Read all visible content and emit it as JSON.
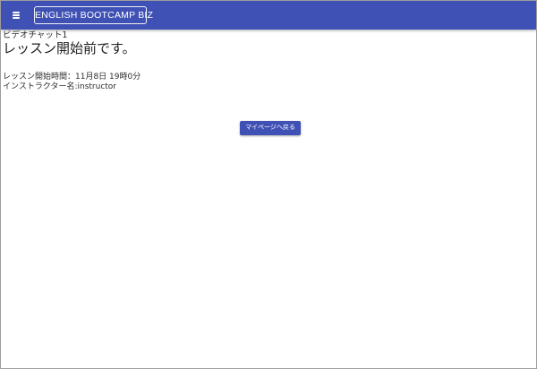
{
  "app_bar": {
    "menu_icon": "menu-icon",
    "brand_label": "ENGLISH BOOTCAMP BIZ",
    "color": "#3f51b5"
  },
  "lesson": {
    "name": "ビデオチャット1",
    "status_heading": "レッスン開始前です。",
    "start_time": "レッスン開始時間：11月8日 19時0分",
    "instructor": "インストラクター名:instructor"
  },
  "actions": {
    "back_to_mypage": "マイページへ戻る"
  }
}
